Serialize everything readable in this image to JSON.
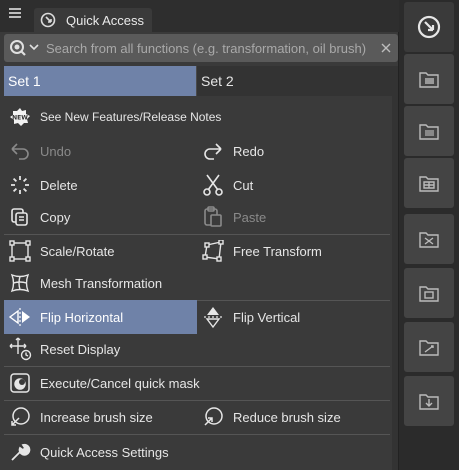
{
  "titlebar": {
    "tab_title": "Quick Access"
  },
  "search": {
    "placeholder": "Search from all functions (e.g. transformation, oil brush)",
    "value": ""
  },
  "sets": [
    {
      "label": "Set 1",
      "active": true
    },
    {
      "label": "Set 2",
      "active": false
    }
  ],
  "items": {
    "new_features": {
      "label": "See New Features/Release Notes",
      "icon": "new-badge-icon"
    },
    "undo": {
      "label": "Undo",
      "icon": "undo-icon",
      "enabled": false
    },
    "redo": {
      "label": "Redo",
      "icon": "redo-icon",
      "enabled": true
    },
    "delete": {
      "label": "Delete",
      "icon": "delete-icon"
    },
    "cut": {
      "label": "Cut",
      "icon": "scissors-icon"
    },
    "copy": {
      "label": "Copy",
      "icon": "copy-icon"
    },
    "paste": {
      "label": "Paste",
      "icon": "paste-icon",
      "enabled": false
    },
    "scale_rotate": {
      "label": "Scale/Rotate",
      "icon": "scale-rotate-icon"
    },
    "free_transform": {
      "label": "Free Transform",
      "icon": "free-transform-icon"
    },
    "mesh_transformation": {
      "label": "Mesh Transformation",
      "icon": "mesh-transform-icon"
    },
    "flip_horizontal": {
      "label": "Flip Horizontal",
      "icon": "flip-horizontal-icon",
      "selected": true
    },
    "flip_vertical": {
      "label": "Flip Vertical",
      "icon": "flip-vertical-icon"
    },
    "reset_display": {
      "label": "Reset Display",
      "icon": "reset-display-icon"
    },
    "quick_mask": {
      "label": "Execute/Cancel quick mask",
      "icon": "quick-mask-icon"
    },
    "increase_brush": {
      "label": "Increase brush size",
      "icon": "increase-brush-icon"
    },
    "reduce_brush": {
      "label": "Reduce brush size",
      "icon": "reduce-brush-icon"
    },
    "settings": {
      "label": "Quick Access Settings",
      "icon": "wrench-icon"
    }
  },
  "colors": {
    "selected": "#6f82a8",
    "panel": "#3a3a3a",
    "titlebar": "#2e2e2e"
  }
}
